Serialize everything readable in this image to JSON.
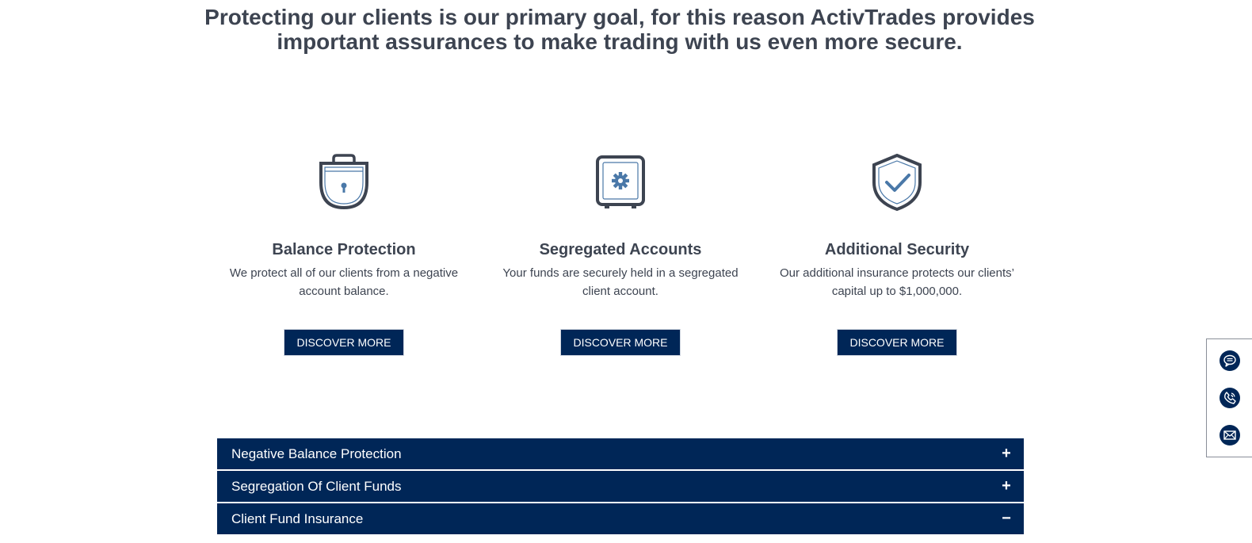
{
  "headline": "Protecting our clients is our primary goal, for this reason ActivTrades provides important assurances to make trading with us even more secure.",
  "features": [
    {
      "icon": "padlock-icon",
      "title": "Balance Protection",
      "description": "We protect all of our clients from a negative account balance.",
      "button": "DISCOVER MORE"
    },
    {
      "icon": "safe-icon",
      "title": "Segregated Accounts",
      "description": "Your funds are securely held in a segregated client account.",
      "button": "DISCOVER MORE"
    },
    {
      "icon": "shield-check-icon",
      "title": "Additional Security",
      "description": "Our additional insurance protects our clients’ capital up to $1,000,000.",
      "button": "DISCOVER MORE"
    }
  ],
  "accordion": [
    {
      "label": "Negative Balance Protection",
      "toggle": "+"
    },
    {
      "label": "Segregation Of Client Funds",
      "toggle": "+"
    },
    {
      "label": "Client Fund Insurance",
      "toggle": "−"
    }
  ],
  "side_widget": {
    "icons": [
      "chat-icon",
      "phone-icon",
      "mail-icon"
    ]
  },
  "colors": {
    "brand_navy": "#002657",
    "text": "#3d4451",
    "icon_accent": "#4a78a8"
  }
}
